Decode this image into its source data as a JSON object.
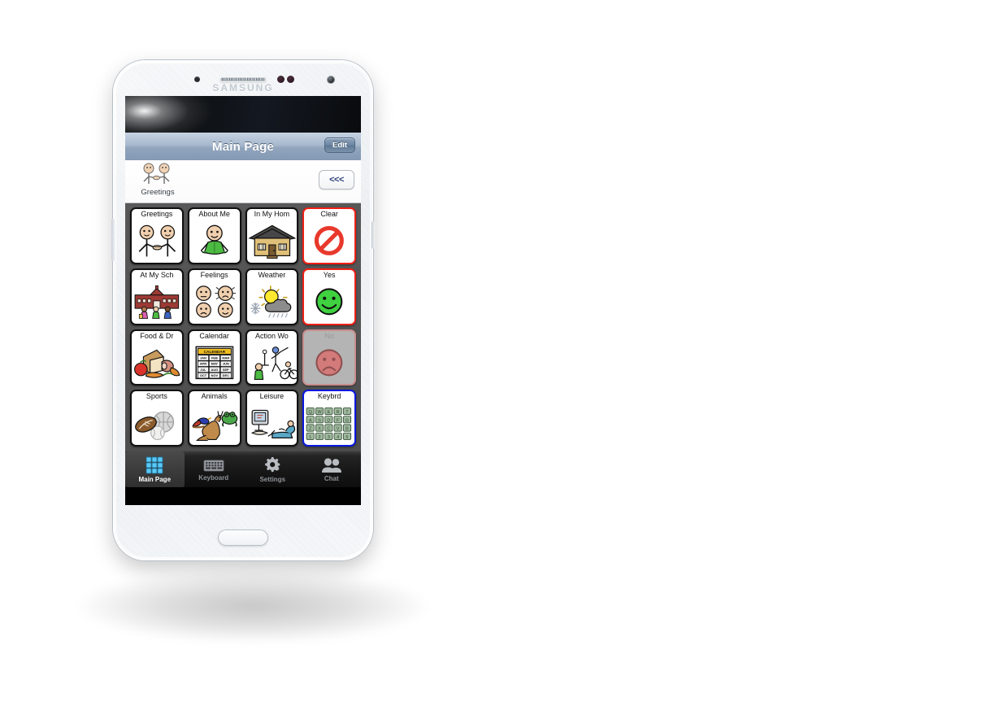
{
  "device": {
    "brand": "SAMSUNG",
    "type": "smartphone-white"
  },
  "app": {
    "title": "Main Page",
    "edit_label": "Edit",
    "back_label": "<<<"
  },
  "message_bar": {
    "item_label": "Greetings",
    "icon": "two-people-greeting-icon"
  },
  "grid": {
    "columns": 4,
    "rows": 4,
    "cells": [
      {
        "label": "Greetings",
        "icon": "two-people-handshake-icon",
        "style": "normal"
      },
      {
        "label": "About Me",
        "icon": "person-green-shirt-icon",
        "style": "normal"
      },
      {
        "label": "In My Hom",
        "icon": "house-icon",
        "style": "normal"
      },
      {
        "label": "Clear",
        "icon": "no-entry-sign-icon",
        "style": "red"
      },
      {
        "label": "At My Sch",
        "icon": "school-building-icon",
        "style": "normal"
      },
      {
        "label": "Feelings",
        "icon": "four-faces-emotions-icon",
        "style": "normal"
      },
      {
        "label": "Weather",
        "icon": "sun-cloud-snow-rain-icon",
        "style": "normal"
      },
      {
        "label": "Yes",
        "icon": "green-smiley-face-icon",
        "style": "red"
      },
      {
        "label": "Food & Dr",
        "icon": "bread-apple-carrot-ham-icon",
        "style": "normal"
      },
      {
        "label": "Calendar",
        "icon": "calendar-months-icon",
        "style": "normal"
      },
      {
        "label": "Action Wo",
        "icon": "people-actions-icon",
        "style": "normal"
      },
      {
        "label": "No",
        "icon": "red-sad-face-icon",
        "style": "dim"
      },
      {
        "label": "Sports",
        "icon": "football-basketball-baseball-icon",
        "style": "normal"
      },
      {
        "label": "Animals",
        "icon": "bird-kangaroo-frog-icon",
        "style": "normal"
      },
      {
        "label": "Leisure",
        "icon": "tv-person-relaxing-icon",
        "style": "normal"
      },
      {
        "label": "Keybrd",
        "icon": "keyboard-keys-icon",
        "style": "blue"
      }
    ]
  },
  "calendar_icon": {
    "header": "CALENDAR",
    "months": [
      "JAN",
      "FEB",
      "MAR",
      "APR",
      "MAY",
      "JUN",
      "JUL",
      "AUG",
      "SEP",
      "OCT",
      "NOV",
      "DEC"
    ]
  },
  "tabbar": {
    "tabs": [
      {
        "label": "Main Page",
        "icon": "grid-icon",
        "active": true
      },
      {
        "label": "Keyboard",
        "icon": "keyboard-icon",
        "active": false
      },
      {
        "label": "Settings",
        "icon": "gear-icon",
        "active": false
      },
      {
        "label": "Chat",
        "icon": "people-icon",
        "active": false
      }
    ]
  },
  "colors": {
    "titlebar_blue": "#8499b3",
    "grid_bg": "#535353",
    "alert_red": "#ef2016",
    "keyboard_blue": "#0a18e0",
    "yes_green": "#3fd13f",
    "no_red": "#d37a7a",
    "tabbar_black": "#0d0d0d",
    "active_tab_blue": "#5bc8f5"
  }
}
